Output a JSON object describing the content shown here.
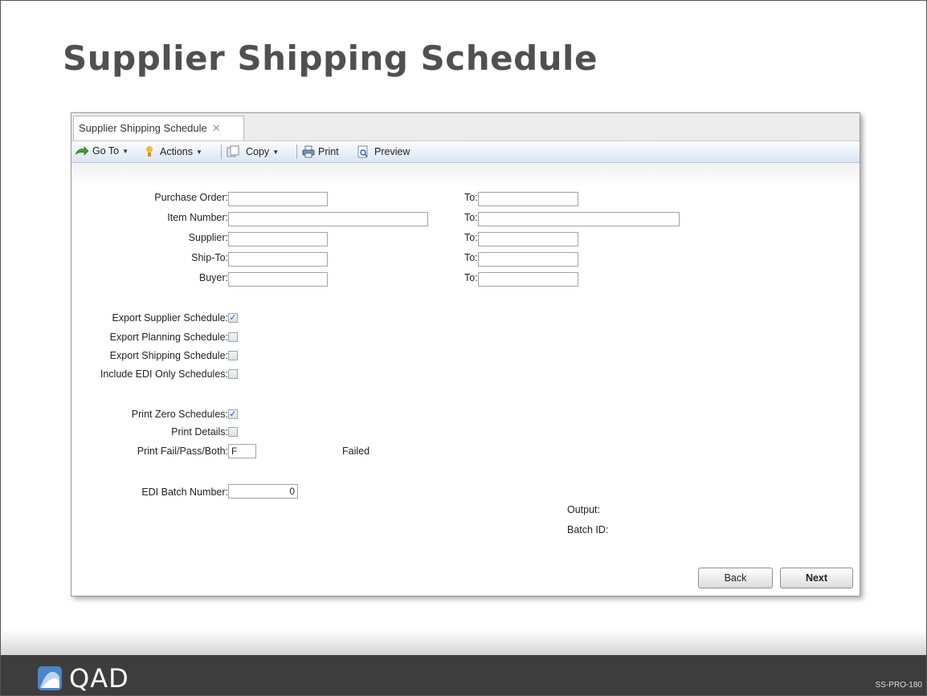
{
  "slide": {
    "title": "Supplier Shipping Schedule",
    "code": "SS-PRO-180",
    "logo_text": "QAD"
  },
  "tab": {
    "label": "Supplier Shipping Schedule",
    "close_glyph": "✕"
  },
  "toolbar": {
    "goto_label": "Go To",
    "actions_label": "Actions",
    "copy_label": "Copy",
    "print_label": "Print",
    "preview_label": "Preview"
  },
  "ranges": [
    {
      "label": "Purchase Order:",
      "from": "",
      "to_label": "To:",
      "to": ""
    },
    {
      "label": "Item Number:",
      "from": "",
      "to_label": "To:",
      "to": ""
    },
    {
      "label": "Supplier:",
      "from": "",
      "to_label": "To:",
      "to": ""
    },
    {
      "label": "Ship-To:",
      "from": "",
      "to_label": "To:",
      "to": ""
    },
    {
      "label": "Buyer:",
      "from": "",
      "to_label": "To:",
      "to": ""
    }
  ],
  "options": {
    "export_supplier": {
      "label": "Export Supplier Schedule:",
      "checked": true
    },
    "export_planning": {
      "label": "Export Planning Schedule:",
      "checked": false
    },
    "export_shipping": {
      "label": "Export Shipping Schedule:",
      "checked": false
    },
    "include_edi": {
      "label": "Include EDI Only Schedules:",
      "checked": false
    },
    "print_zero": {
      "label": "Print Zero Schedules:",
      "checked": true
    },
    "print_details": {
      "label": "Print Details:",
      "checked": false
    }
  },
  "print_fail": {
    "label": "Print Fail/Pass/Both:",
    "value": "F",
    "description": "Failed"
  },
  "edi_batch": {
    "label": "EDI Batch Number:",
    "value": "0"
  },
  "output": {
    "output_label": "Output:",
    "batch_id_label": "Batch ID:"
  },
  "buttons": {
    "back": "Back",
    "next": "Next"
  },
  "colors": {
    "footer": "#3d3d3d",
    "title": "#505050",
    "toolbar_gradient_end": "#dbe6f4"
  }
}
